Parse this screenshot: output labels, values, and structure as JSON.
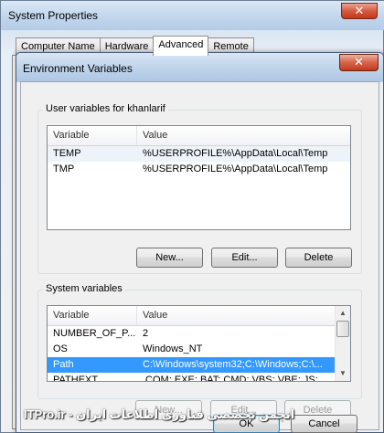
{
  "background_window": {
    "title": "System Properties",
    "close_label": "✕",
    "tabs": [
      {
        "label": "Computer Name"
      },
      {
        "label": "Hardware"
      },
      {
        "label": "Advanced"
      },
      {
        "label": "Remote"
      }
    ]
  },
  "dialog": {
    "title": "Environment Variables",
    "close_label": "✕",
    "user_vars": {
      "group_label": "User variables for khanlarif",
      "columns": {
        "variable": "Variable",
        "value": "Value"
      },
      "rows": [
        {
          "variable": "TEMP",
          "value": "%USERPROFILE%\\AppData\\Local\\Temp"
        },
        {
          "variable": "TMP",
          "value": "%USERPROFILE%\\AppData\\Local\\Temp"
        }
      ],
      "buttons": {
        "new": "New...",
        "edit": "Edit...",
        "delete": "Delete"
      }
    },
    "system_vars": {
      "group_label": "System variables",
      "columns": {
        "variable": "Variable",
        "value": "Value"
      },
      "rows": [
        {
          "variable": "NUMBER_OF_P...",
          "value": "2"
        },
        {
          "variable": "OS",
          "value": "Windows_NT"
        },
        {
          "variable": "Path",
          "value": "C:\\Windows\\system32;C:\\Windows;C:\\..."
        },
        {
          "variable": "PATHEXT",
          "value": ".COM;.EXE;.BAT;.CMD;.VBS;.VBE;.JS;...."
        }
      ],
      "selected_row": 2,
      "buttons": {
        "new": "New...",
        "edit": "Edit...",
        "delete": "Delete"
      }
    },
    "ok_label": "OK",
    "cancel_label": "Cancel"
  },
  "watermark": "ITPro.ir - انجمن تخصصی فناوری اطلاعات ایران",
  "colors": {
    "selection": "#3399ff",
    "title_gradient": "#c2d6ec"
  }
}
